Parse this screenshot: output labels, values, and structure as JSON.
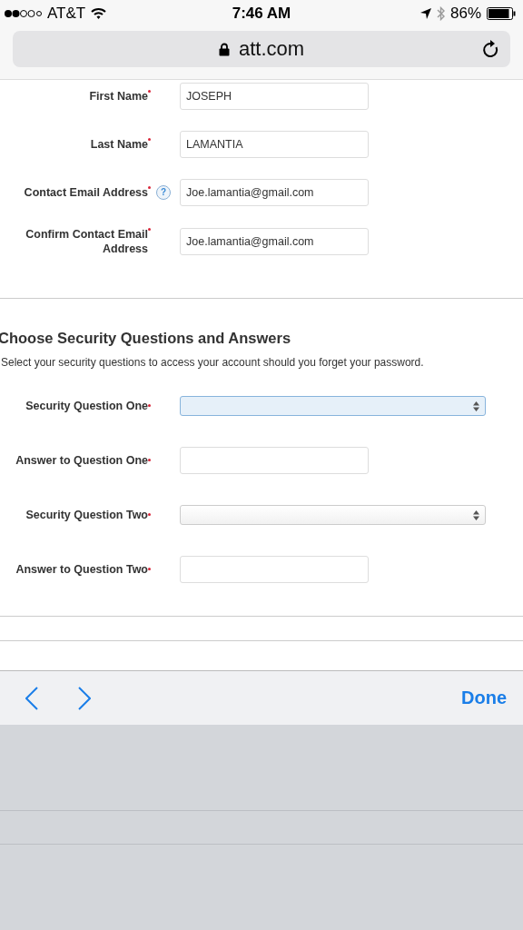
{
  "status_bar": {
    "carrier": "AT&T",
    "time": "7:46 AM",
    "battery": "86%"
  },
  "address_bar": {
    "url": "att.com"
  },
  "contact_fields": [
    {
      "kind": "text",
      "label": "First Name",
      "required": true,
      "value": "JOSEPH",
      "focused": false
    },
    {
      "kind": "text",
      "label": "Last Name",
      "required": true,
      "value": "LAMANTIA",
      "focused": false
    },
    {
      "kind": "text",
      "label": "Contact Email Address",
      "required": true,
      "help": "?",
      "value": "Joe.lamantia@gmail.com",
      "focused": false
    },
    {
      "kind": "text",
      "label": "Confirm Contact Email Address",
      "required": true,
      "value": "Joe.lamantia@gmail.com",
      "focused": false
    }
  ],
  "security_section": {
    "title": "Choose Security Questions and Answers",
    "description": "Select your security questions to access your account should you forget your password.",
    "fields": [
      {
        "kind": "select",
        "label": "Security Question One",
        "required": true,
        "focused": true
      },
      {
        "kind": "text",
        "label": "Answer to Question One",
        "required": true,
        "focused": false
      },
      {
        "kind": "select",
        "label": "Security Question Two",
        "required": true,
        "focused": false
      },
      {
        "kind": "text",
        "label": "Answer to Question Two",
        "required": true,
        "focused": false
      }
    ]
  },
  "keyboard_toolbar": {
    "done": "Done"
  }
}
